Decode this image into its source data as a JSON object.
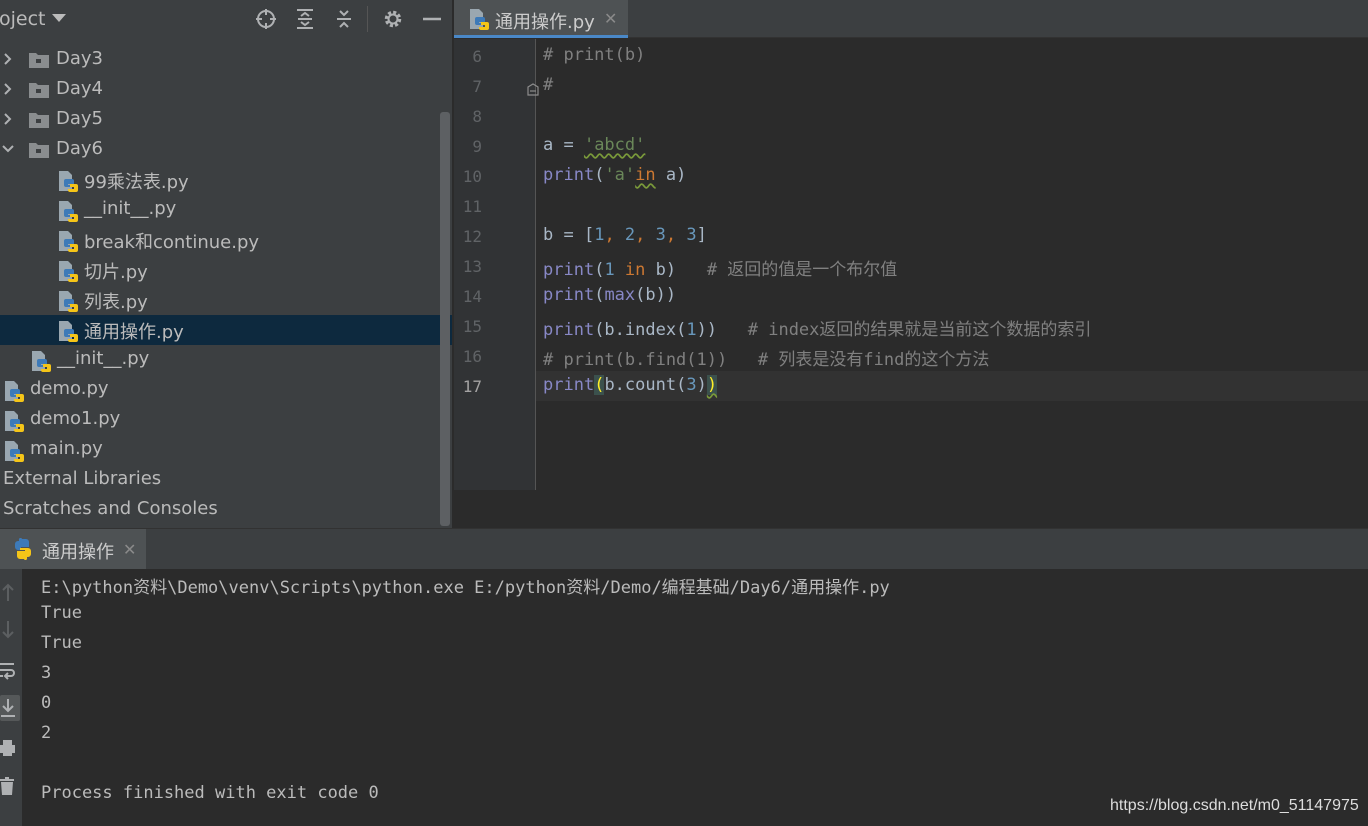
{
  "project_panel": {
    "title": "oject",
    "header_icons": [
      "locate-crosshair-icon",
      "expand-all-icon",
      "collapse-all-icon",
      "settings-gear-icon",
      "hide-minus-icon"
    ],
    "tree": [
      {
        "label": "Day3",
        "type": "folder",
        "expanded": false
      },
      {
        "label": "Day4",
        "type": "folder",
        "expanded": false
      },
      {
        "label": "Day5",
        "type": "folder",
        "expanded": false
      },
      {
        "label": "Day6",
        "type": "folder",
        "expanded": true
      },
      {
        "label": "99乘法表.py",
        "type": "python-file"
      },
      {
        "label": "__init__.py",
        "type": "python-file"
      },
      {
        "label": "break和continue.py",
        "type": "python-file"
      },
      {
        "label": "切片.py",
        "type": "python-file"
      },
      {
        "label": "列表.py",
        "type": "python-file"
      },
      {
        "label": "通用操作.py",
        "type": "python-file",
        "selected": true
      },
      {
        "label": "__init__.py",
        "type": "python-file"
      },
      {
        "label": "demo.py",
        "type": "python-file"
      },
      {
        "label": "demo1.py",
        "type": "python-file"
      },
      {
        "label": "main.py",
        "type": "python-file"
      },
      {
        "label": "External Libraries",
        "type": "group"
      },
      {
        "label": "Scratches and Consoles",
        "type": "group"
      }
    ]
  },
  "editor": {
    "tab": {
      "label": "通用操作.py",
      "close": "✕"
    },
    "line_numbers": [
      "6",
      "7",
      "8",
      "9",
      "10",
      "11",
      "12",
      "13",
      "14",
      "15",
      "16",
      "17"
    ],
    "current_line": "17",
    "code": {
      "l6": "# print(b)",
      "l7": "#",
      "l9_a": "a = ",
      "l9_str": "'abcd'",
      "l10_print": "print",
      "l10_open": "(",
      "l10_str": "'a'",
      "l10_in": "in",
      "l10_rest": " a)",
      "l12_a": "b = [",
      "l12_1": "1",
      "l12_c1": ", ",
      "l12_2": "2",
      "l12_c2": ", ",
      "l12_3": "3",
      "l12_c3": ", ",
      "l12_4": "3",
      "l12_end": "]",
      "l13_print": "print",
      "l13_open": "(",
      "l13_1": "1",
      "l13_in": " in",
      "l13_rest": " b)   ",
      "l13_comment": "# 返回的值是一个布尔值",
      "l14_print": "print",
      "l14_open": "(",
      "l14_max": "max",
      "l14_rest": "(b))",
      "l15_print": "print",
      "l15_mid": "(b.index(",
      "l15_1": "1",
      "l15_end": "))   ",
      "l15_comment": "# index返回的结果就是当前这个数据的索引",
      "l16_comment": "# print(b.find(1))   # 列表是没有find的这个方法",
      "l17_print": "print",
      "l17_open": "(",
      "l17_mid": "b.count(",
      "l17_3": "3",
      "l17_close1": ")",
      "l17_close2": ")"
    }
  },
  "run_panel": {
    "tab": {
      "label": "通用操作",
      "close": "✕"
    },
    "toolbar_icons": [
      "up-arrow-icon",
      "down-arrow-icon",
      "soft-wrap-icon",
      "scroll-to-end-icon",
      "print-icon",
      "trash-icon"
    ],
    "console_lines": [
      "E:\\python资料\\Demo\\venv\\Scripts\\python.exe E:/python资料/Demo/编程基础/Day6/通用操作.py",
      "True",
      "True",
      "3",
      "0",
      "2",
      "",
      "Process finished with exit code 0"
    ]
  },
  "watermark": "https://blog.csdn.net/m0_51147975",
  "colors": {
    "panel_bg": "#3c3f41",
    "editor_bg": "#2b2b2b",
    "selection": "#0d293e",
    "keyword": "#cc7832",
    "string": "#6a8759",
    "number": "#6897bb",
    "builtin": "#8888c6",
    "comment": "#808080"
  }
}
